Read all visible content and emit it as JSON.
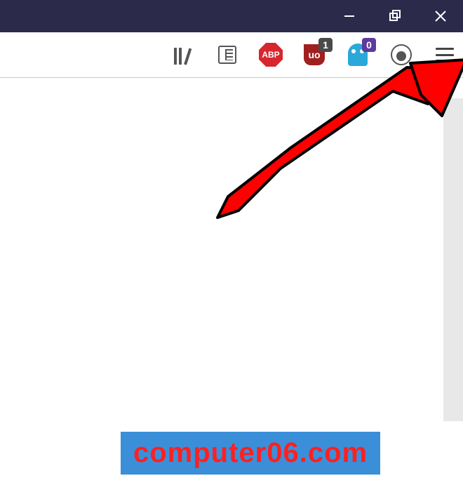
{
  "titlebar": {
    "minimize": "minimize",
    "maximize": "maximize-restore",
    "close": "close"
  },
  "toolbar": {
    "library_name": "library-icon",
    "reader_name": "reader-view-icon",
    "abp_label": "ABP",
    "ubo_label": "uo",
    "ubo_badge": "1",
    "ghost_badge": "0",
    "profile_name": "profile-icon",
    "menu_name": "hamburger-menu-icon"
  },
  "annotation": {
    "arrow_target": "hamburger-menu"
  },
  "watermark": "computer06.com"
}
